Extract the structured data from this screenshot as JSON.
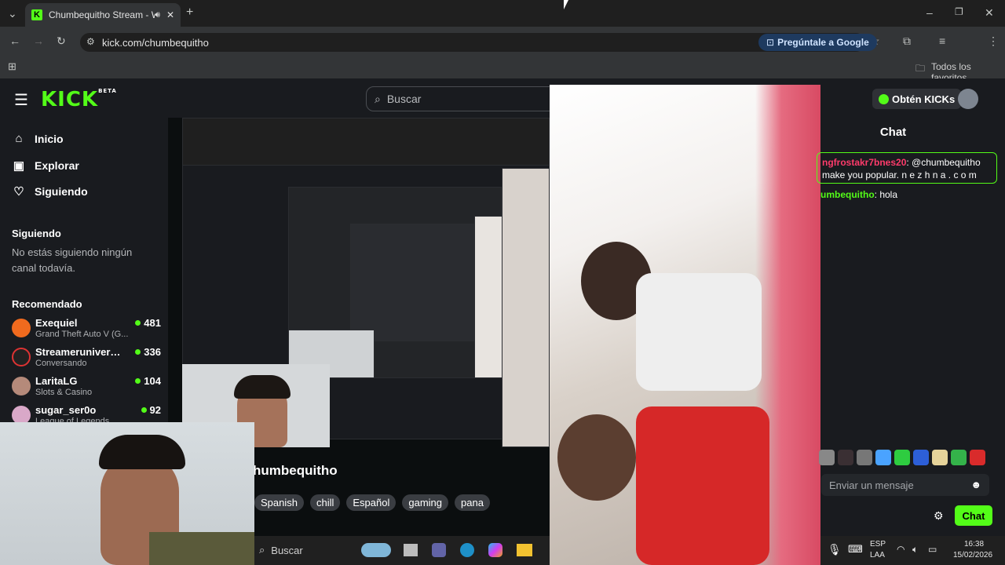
{
  "browser": {
    "tab_title": "Chumbequitho Stream - W",
    "tab_favicon": "K",
    "url": "kick.com/chumbequitho",
    "google_button": "Pregúntale a Google",
    "bookmarks_folder": "Todos los favoritos"
  },
  "header": {
    "logo": "KICK",
    "logo_badge": "BETA",
    "search_placeholder": "Buscar",
    "kicks_button": "Obtén KICKs"
  },
  "sidebar": {
    "nav": [
      {
        "label": "Inicio",
        "icon": "home-icon"
      },
      {
        "label": "Explorar",
        "icon": "compass-icon"
      },
      {
        "label": "Siguiendo",
        "icon": "heart-icon"
      }
    ],
    "following_title": "Siguiendo",
    "following_empty": "No estás siguiendo ningún canal todavía.",
    "recommended_title": "Recomendado",
    "channels": [
      {
        "name": "Exequiel",
        "game": "Grand Theft Auto V (G...",
        "viewers": "481",
        "color": "#f06a1e"
      },
      {
        "name": "Streameruniversit...",
        "game": "Conversando",
        "viewers": "336",
        "color": "#222222"
      },
      {
        "name": "LaritaLG",
        "game": "Slots & Casino",
        "viewers": "104",
        "color": "#b58a7a"
      },
      {
        "name": "sugar_ser0o",
        "game": "League of Legends",
        "viewers": "92",
        "color": "#d9a8c8"
      }
    ]
  },
  "stream": {
    "channel_name": "humbequitho",
    "tags": [
      "Spanish",
      "chill",
      "Español",
      "gaming",
      "pana"
    ]
  },
  "taskbar": {
    "search": "Buscar",
    "lang_top": "ESP",
    "lang_bottom": "LAA",
    "time": "16:38",
    "date": "15/02/2026"
  },
  "chat": {
    "title": "Chat",
    "pinned_user": "ngfrostakr7bnes20",
    "pinned_text_1": "@chumbequitho",
    "pinned_text_2": "make you popular. n e z h n a . c o m",
    "msg_user": "umbequitho",
    "msg_text": "hola",
    "input_placeholder": "Enviar un mensaje",
    "send_button": "Chat"
  }
}
